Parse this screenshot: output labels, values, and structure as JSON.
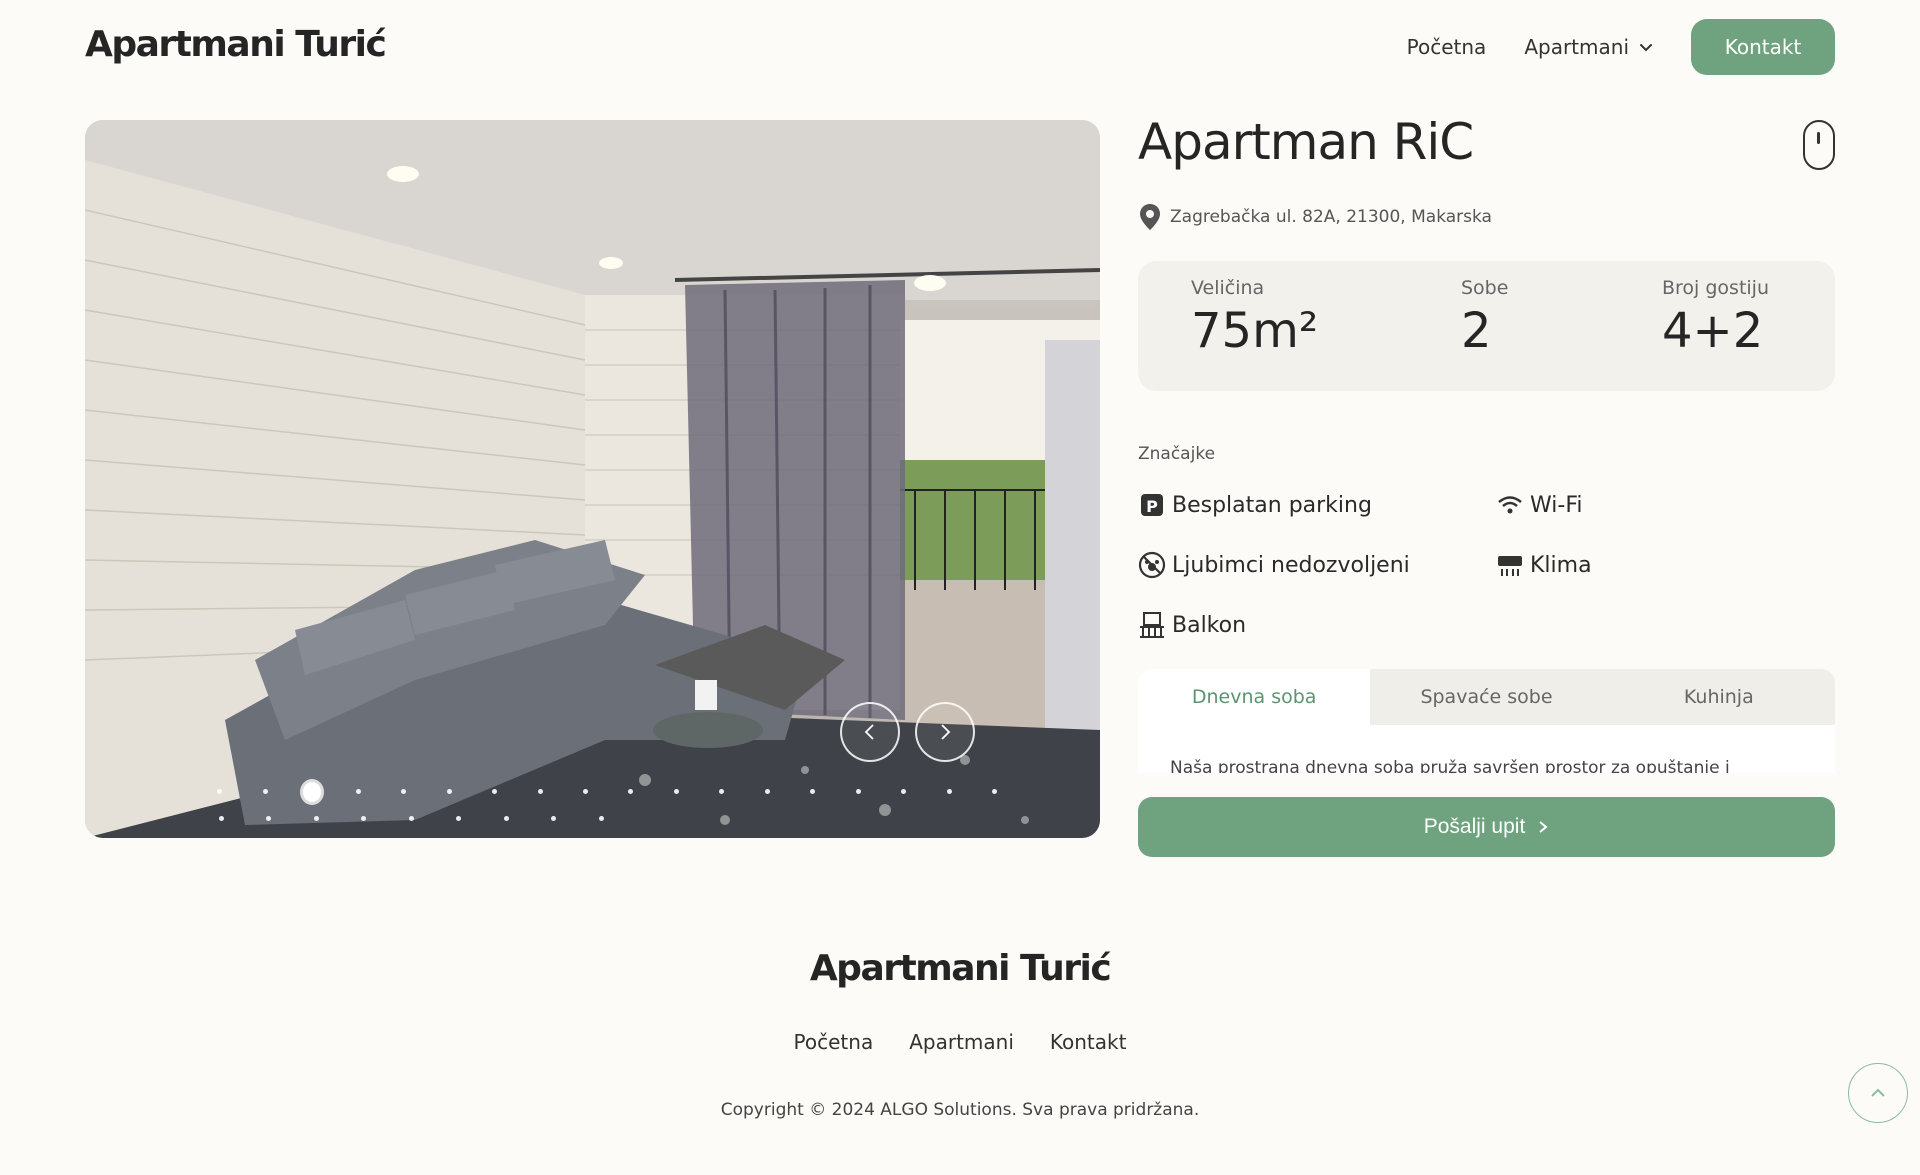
{
  "header": {
    "logo": "Apartmani Turić",
    "nav": {
      "home": "Početna",
      "apartments": "Apartmani",
      "contact": "Kontakt"
    }
  },
  "gallery": {
    "total_slides": 27,
    "active_slide_index": 2
  },
  "apartment": {
    "title": "Apartman RiC",
    "address": "Zagrebačka ul. 82A, 21300, Makarska",
    "stats": {
      "size_label": "Veličina",
      "size_value": "75m²",
      "rooms_label": "Sobe",
      "rooms_value": "2",
      "guests_label": "Broj gostiju",
      "guests_value": "4+2"
    },
    "features_title": "Značajke",
    "features": {
      "parking": "Besplatan parking",
      "wifi": "Wi-Fi",
      "pets": "Ljubimci nedozvoljeni",
      "ac": "Klima",
      "balcony": "Balkon"
    },
    "tabs": {
      "living": "Dnevna soba",
      "bedrooms": "Spavaće sobe",
      "kitchen": "Kuhinja"
    },
    "tab_text": "Naša prostrana dnevna soba pruža savršen prostor za opuštanje i",
    "send_button": "Pošalji upit"
  },
  "footer": {
    "logo": "Apartmani Turić",
    "nav": {
      "home": "Početna",
      "apartments": "Apartmani",
      "contact": "Kontakt"
    },
    "copyright": "Copyright © 2024 ALGO Solutions. Sva prava pridržana."
  },
  "colors": {
    "accent": "#6fa27e",
    "background": "#fcfbf8",
    "stats_bg": "#f3f1ec"
  }
}
